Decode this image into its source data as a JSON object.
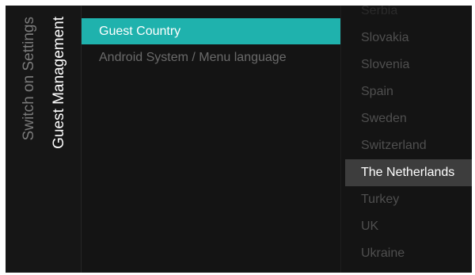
{
  "breadcrumb": {
    "parent": "Switch on Settings",
    "current": "Guest Management"
  },
  "menu": {
    "items": [
      {
        "label": "Guest Country",
        "active": true
      },
      {
        "label": "Android System / Menu language",
        "active": false
      }
    ]
  },
  "countries": {
    "items": [
      "Serbia",
      "Slovakia",
      "Slovenia",
      "Spain",
      "Sweden",
      "Switzerland",
      "The Netherlands",
      "Turkey",
      "UK",
      "Ukraine"
    ],
    "selected": "The Netherlands"
  },
  "colors": {
    "accent": "#1fb2ad",
    "background": "#141414",
    "selected_row": "#3d3d3d"
  }
}
